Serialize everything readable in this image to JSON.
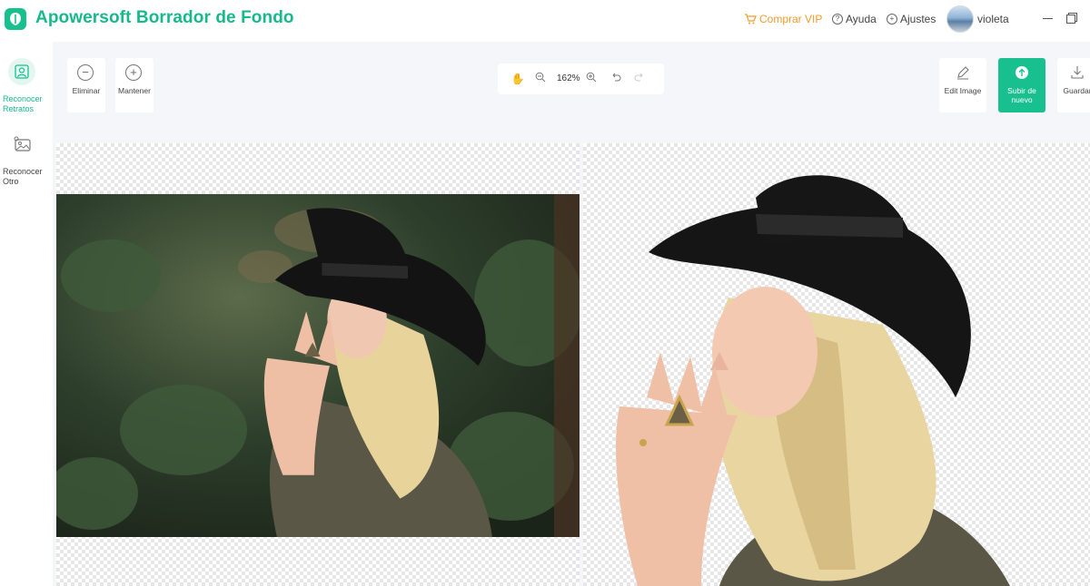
{
  "app": {
    "title": "Apowersoft Borrador de Fondo"
  },
  "header": {
    "vip_label": "Comprar VIP",
    "help_label": "Ayuda",
    "settings_label": "Ajustes",
    "username": "violeta"
  },
  "sidebar": {
    "items": [
      {
        "label": "Reconocer Retratos",
        "icon": "portrait-icon",
        "active": true
      },
      {
        "label": "Reconocer Otro",
        "icon": "object-icon",
        "active": false
      }
    ]
  },
  "toolbar": {
    "remove_label": "Eliminar",
    "keep_label": "Mantener",
    "zoom_value": "162%",
    "edit_label": "Edit Image",
    "upload_label": "Subir de nuevo",
    "save_label": "Guardar"
  },
  "colors": {
    "accent": "#19c08f",
    "vip": "#f29a2e"
  }
}
